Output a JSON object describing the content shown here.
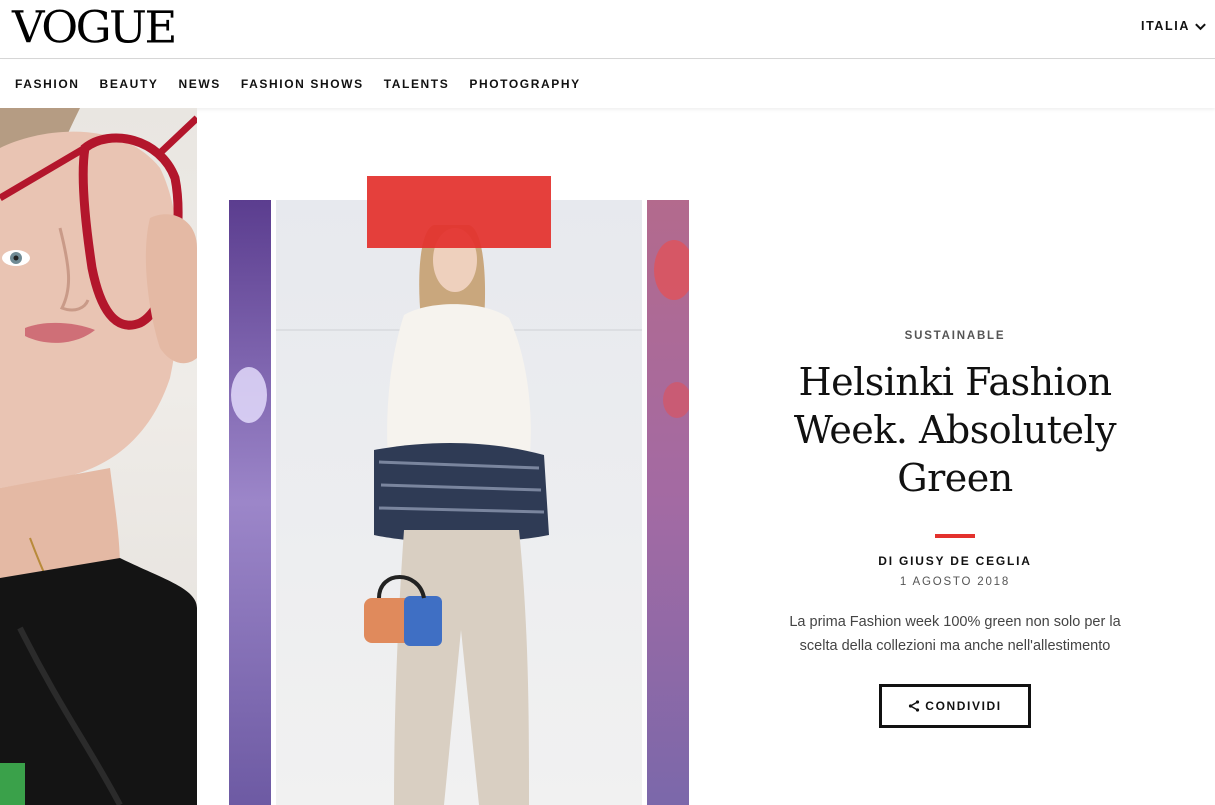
{
  "header": {
    "logo": "VOGUE",
    "edition": "ITALIA",
    "edition_icon": "chevron-down-icon"
  },
  "nav": {
    "items": [
      "FASHION",
      "BEAUTY",
      "NEWS",
      "FASHION SHOWS",
      "TALENTS",
      "PHOTOGRAPHY"
    ]
  },
  "article": {
    "category": "SUSTAINABLE",
    "title": "Helsinki Fashion Week. Absolutely Green",
    "byline": "DI GIUSY DE CEGLIA",
    "date": "1 AGOSTO 2018",
    "dek": "La prima Fashion week 100% green non solo per la scelta della collezioni ma anche nell'allestimento",
    "share_label": "CONDIVIDI",
    "share_icon": "share-icon"
  },
  "colors": {
    "accent": "#e3312d",
    "text": "#111111",
    "muted": "#555555"
  }
}
